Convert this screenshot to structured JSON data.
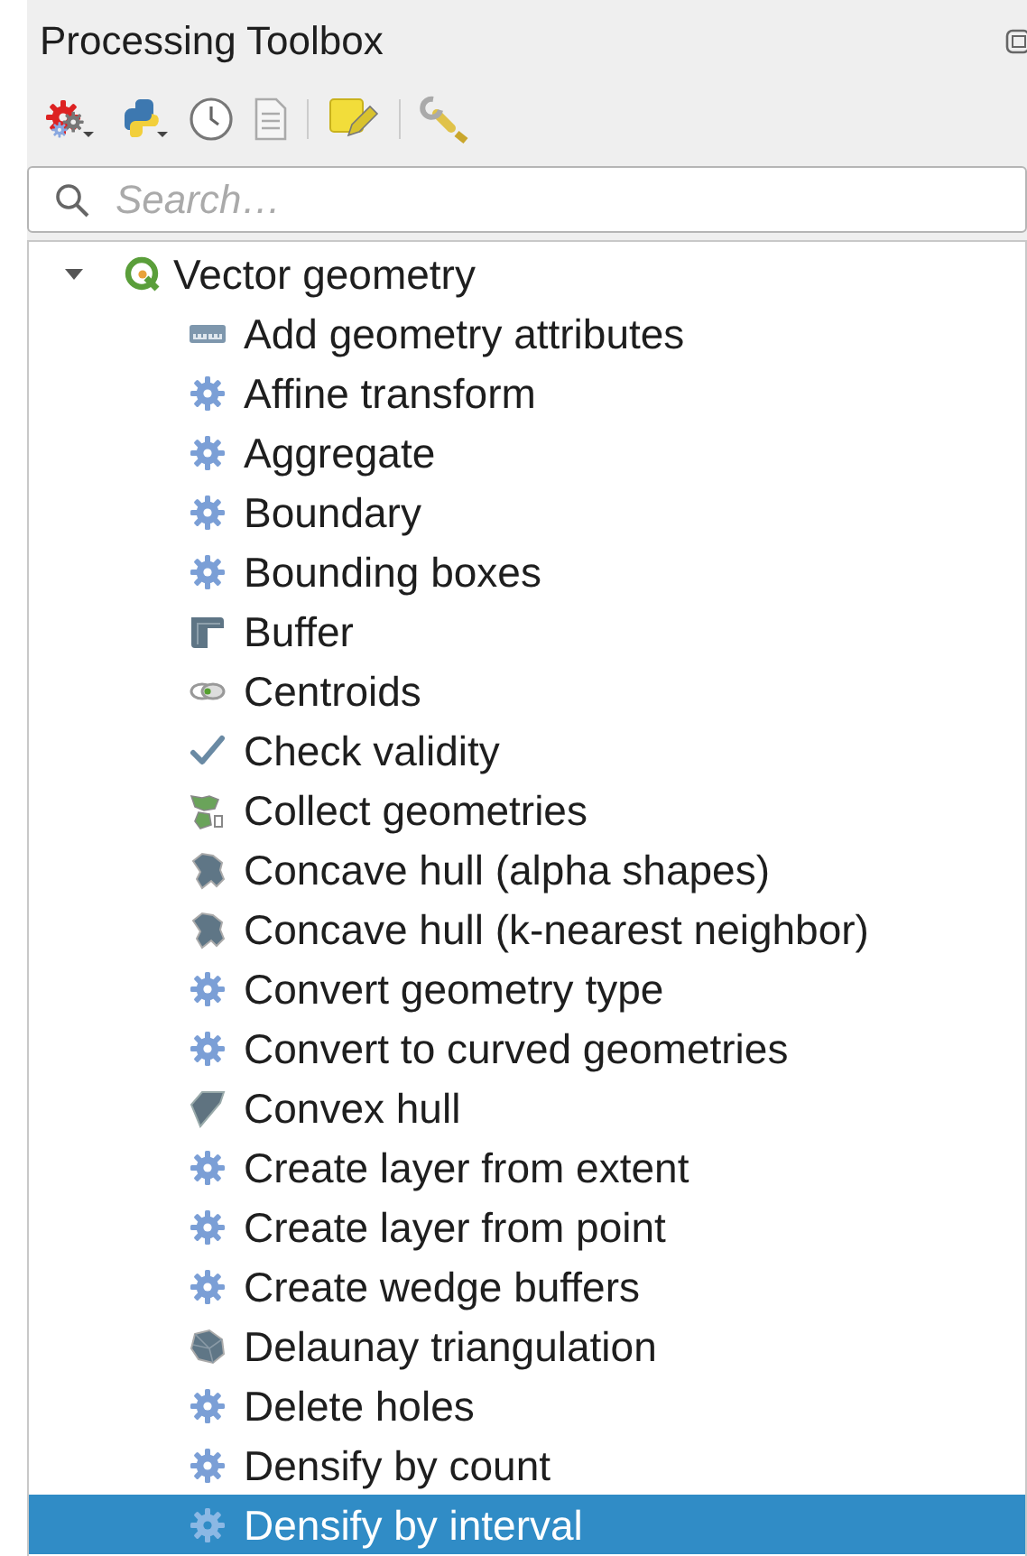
{
  "panel": {
    "title": "Processing Toolbox"
  },
  "search": {
    "placeholder": "Search…"
  },
  "tree": [
    {
      "label": "Vector geometry",
      "expanded": true,
      "selected": false,
      "children": [
        {
          "label": "Add geometry attributes",
          "kind": "ruler",
          "selected": false
        },
        {
          "label": "Affine transform",
          "kind": "gear",
          "selected": false
        },
        {
          "label": "Aggregate",
          "kind": "gear",
          "selected": false
        },
        {
          "label": "Boundary",
          "kind": "gear",
          "selected": false
        },
        {
          "label": "Bounding boxes",
          "kind": "gear",
          "selected": false
        },
        {
          "label": "Buffer",
          "kind": "buffer",
          "selected": false
        },
        {
          "label": "Centroids",
          "kind": "centroids",
          "selected": false
        },
        {
          "label": "Check validity",
          "kind": "check",
          "selected": false
        },
        {
          "label": "Collect geometries",
          "kind": "collect",
          "selected": false
        },
        {
          "label": "Concave hull (alpha shapes)",
          "kind": "concave",
          "selected": false
        },
        {
          "label": "Concave hull (k-nearest neighbor)",
          "kind": "concave",
          "selected": false
        },
        {
          "label": "Convert geometry type",
          "kind": "gear",
          "selected": false
        },
        {
          "label": "Convert to curved geometries",
          "kind": "gear",
          "selected": false
        },
        {
          "label": "Convex hull",
          "kind": "convex",
          "selected": false
        },
        {
          "label": "Create layer from extent",
          "kind": "gear",
          "selected": false
        },
        {
          "label": "Create layer from point",
          "kind": "gear",
          "selected": false
        },
        {
          "label": "Create wedge buffers",
          "kind": "gear",
          "selected": false
        },
        {
          "label": "Delaunay triangulation",
          "kind": "delaunay",
          "selected": false
        },
        {
          "label": "Delete holes",
          "kind": "gear",
          "selected": false
        },
        {
          "label": "Densify by count",
          "kind": "gear",
          "selected": false
        },
        {
          "label": "Densify by interval",
          "kind": "gear",
          "selected": true
        }
      ]
    }
  ]
}
